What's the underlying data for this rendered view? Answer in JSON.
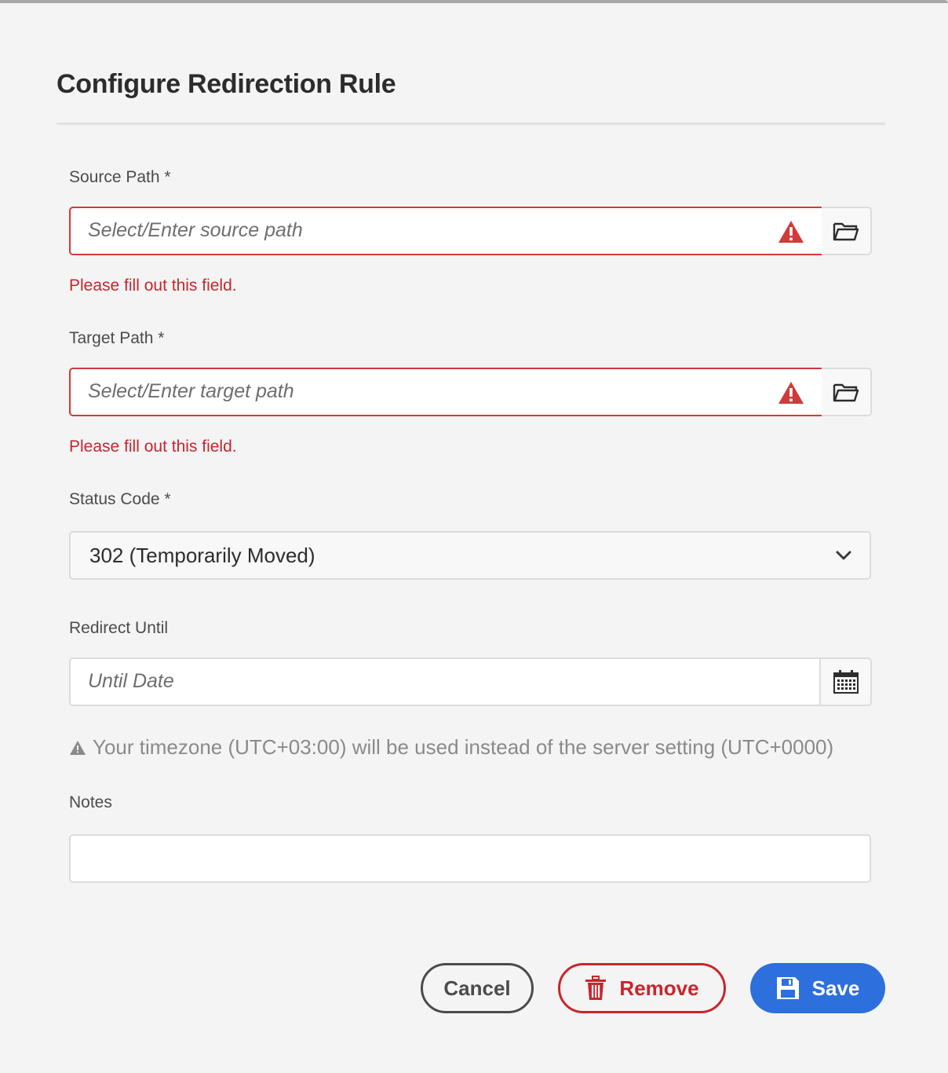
{
  "dialog": {
    "title": "Configure Redirection Rule"
  },
  "source_path": {
    "label": "Source Path *",
    "placeholder": "Select/Enter source path",
    "error": "Please fill out this field."
  },
  "target_path": {
    "label": "Target Path *",
    "placeholder": "Select/Enter target path",
    "error": "Please fill out this field."
  },
  "status_code": {
    "label": "Status Code *",
    "selected": "302 (Temporarily Moved)"
  },
  "redirect_until": {
    "label": "Redirect Until",
    "placeholder": "Until Date",
    "timezone_hint": "Your timezone (UTC+03:00) will be used instead of the server setting (UTC+0000)"
  },
  "notes": {
    "label": "Notes",
    "value": ""
  },
  "actions": {
    "cancel": "Cancel",
    "remove": "Remove",
    "save": "Save"
  },
  "icons": {
    "alert": "alert-icon",
    "folder": "folder-icon",
    "calendar": "calendar-icon",
    "chevron": "chevron-down-icon",
    "trash": "trash-icon",
    "save": "floppy-disk-icon"
  },
  "colors": {
    "error": "#c9252d",
    "primary": "#2d6fdc",
    "background": "#f4f4f4"
  }
}
